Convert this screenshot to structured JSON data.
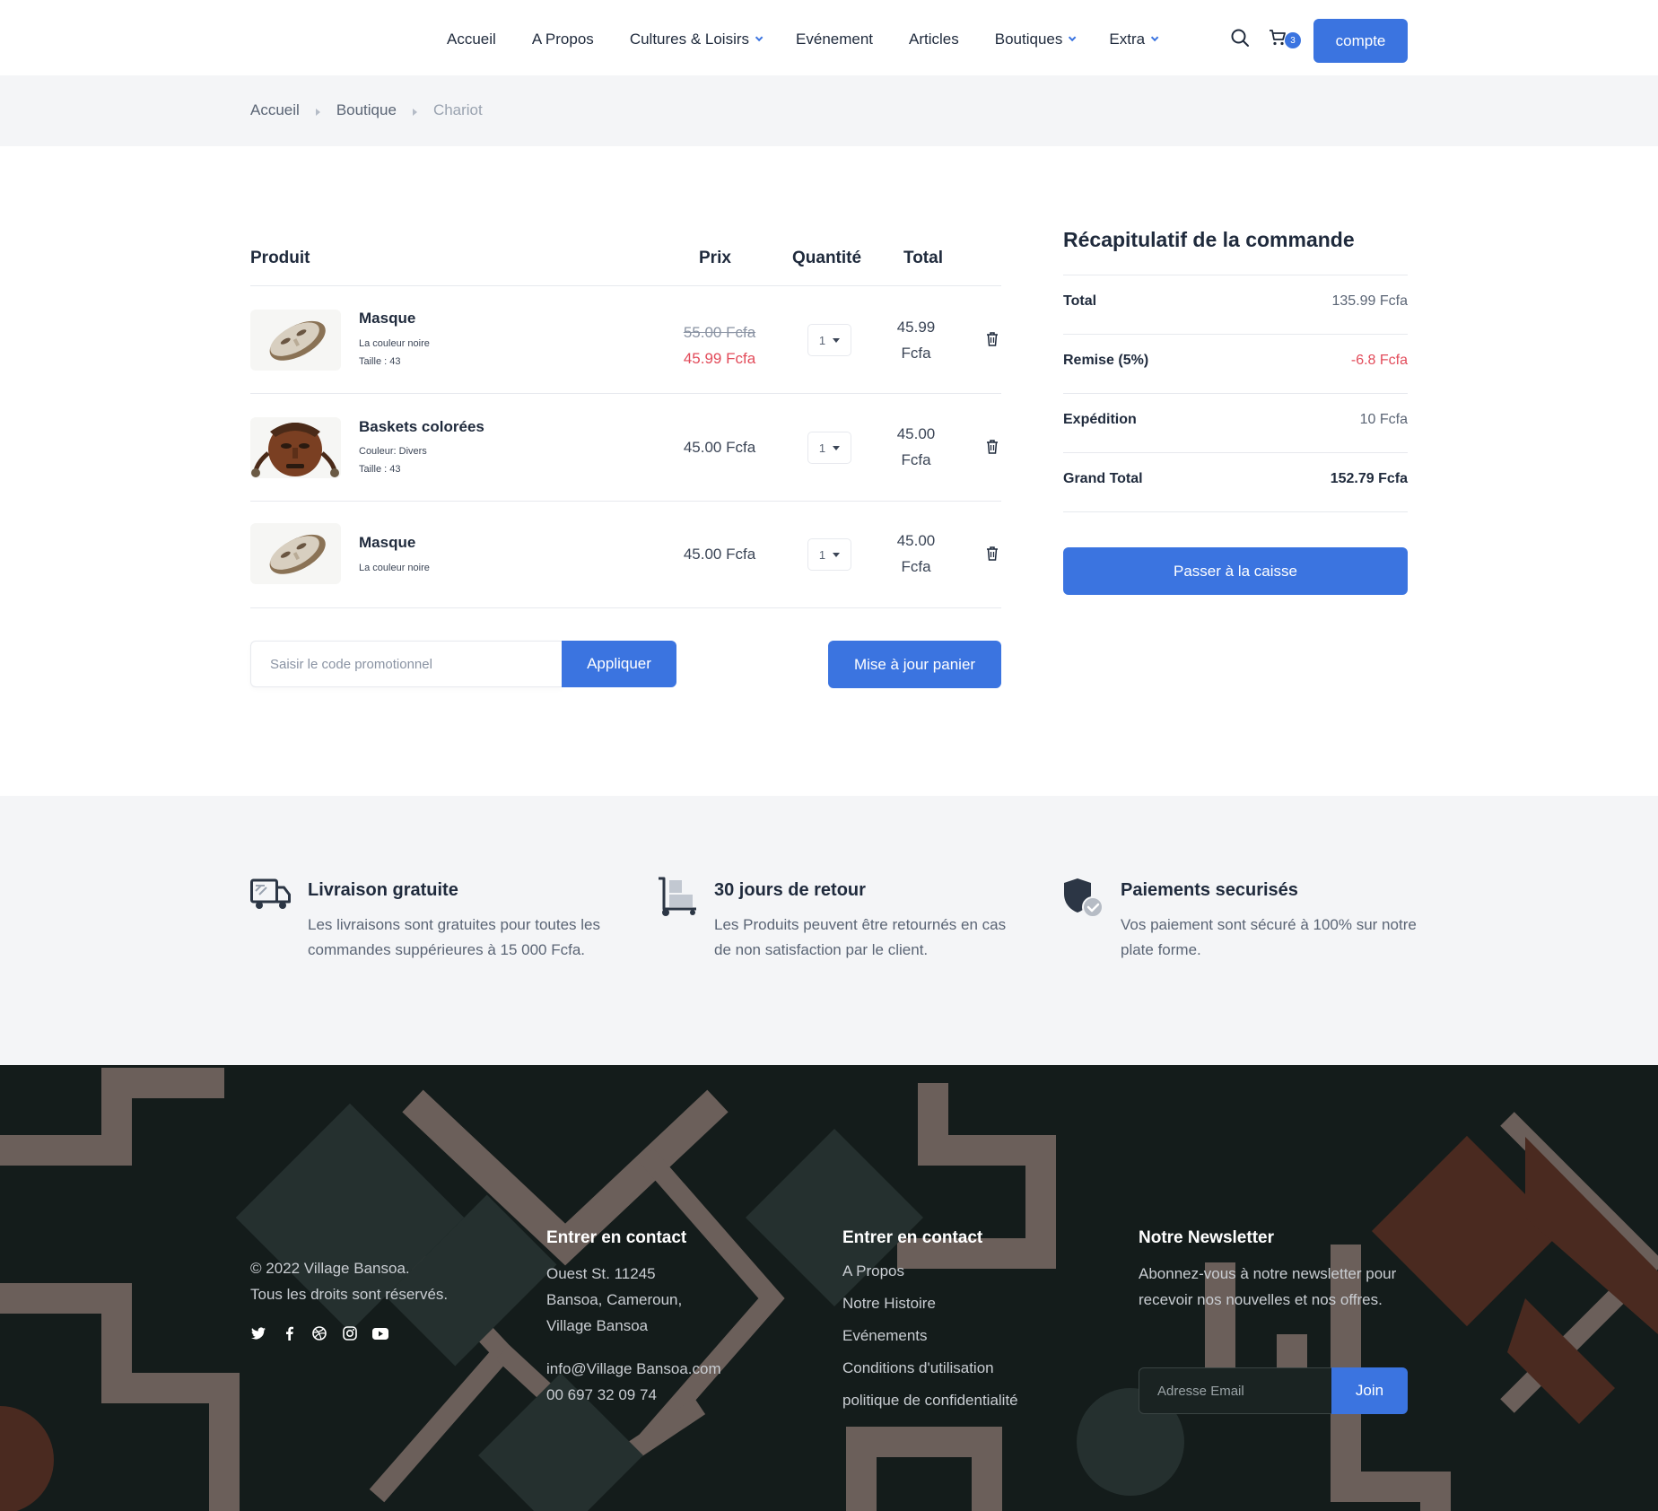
{
  "colors": {
    "accent": "#3b74e0",
    "discount": "#e24b5a",
    "footer_bg": "#141c1b",
    "light_bg": "#f4f5f7"
  },
  "nav": {
    "items": [
      {
        "label": "Accueil",
        "dropdown": false
      },
      {
        "label": "A Propos",
        "dropdown": false
      },
      {
        "label": "Cultures & Loisirs",
        "dropdown": true
      },
      {
        "label": "Evénement",
        "dropdown": false
      },
      {
        "label": "Articles",
        "dropdown": false
      },
      {
        "label": "Boutiques",
        "dropdown": true
      },
      {
        "label": "Extra",
        "dropdown": true
      }
    ],
    "cart_count": "3",
    "account_label": "compte",
    "icons": [
      "search-icon",
      "cart-icon"
    ]
  },
  "breadcrumb": {
    "items": [
      "Accueil",
      "Boutique"
    ],
    "current": "Chariot"
  },
  "cart": {
    "headers": {
      "product": "Produit",
      "price": "Prix",
      "quantity": "Quantité",
      "total": "Total"
    },
    "items": [
      {
        "name": "Masque",
        "meta1": "La couleur noire",
        "meta2": "Taille : 43",
        "old_price": "55.00 Fcfa",
        "price": "45.99 Fcfa",
        "qty": "1",
        "total_line1": "45.99",
        "total_line2": "Fcfa",
        "image": "white-mask"
      },
      {
        "name": "Baskets colorées",
        "meta1": "Couleur: Divers",
        "meta2": "Taille : 43",
        "price": "45.00 Fcfa",
        "qty": "1",
        "total_line1": "45.00",
        "total_line2": "Fcfa",
        "image": "brown-mask"
      },
      {
        "name": "Masque",
        "meta1": "La couleur noire",
        "price": "45.00 Fcfa",
        "qty": "1",
        "total_line1": "45.00",
        "total_line2": "Fcfa",
        "image": "white-mask"
      }
    ],
    "promo_placeholder": "Saisir le code promotionnel",
    "apply_label": "Appliquer",
    "update_label": "Mise à jour panier"
  },
  "summary": {
    "title": "Récapitulatif de la commande",
    "rows": [
      {
        "label": "Total",
        "value": "135.99 Fcfa"
      },
      {
        "label": "Remise (5%)",
        "value": "-6.8 Fcfa"
      },
      {
        "label": "Expédition",
        "value": "10 Fcfa"
      },
      {
        "label": "Grand Total",
        "value": "152.79 Fcfa"
      }
    ],
    "checkout_label": "Passer à la caisse"
  },
  "features": [
    {
      "icon": "truck-icon",
      "title": "Livraison gratuite",
      "text": "Les livraisons sont gratuites pour toutes les commandes suppérieures à 15 000 Fcfa."
    },
    {
      "icon": "hand-truck-icon",
      "title": "30 jours de retour",
      "text": "Les Produits peuvent être retournés en cas de non satisfaction par le client."
    },
    {
      "icon": "shield-check-icon",
      "title": "Paiements securisés",
      "text": "Vos paiement sont sécuré à 100% sur notre plate forme."
    }
  ],
  "footer": {
    "copyright_line1": "© 2022 Village Bansoa.",
    "copyright_line2": "Tous les droits sont réservés.",
    "socials": [
      "twitter-icon",
      "facebook-icon",
      "dribbble-icon",
      "instagram-icon",
      "youtube-icon"
    ],
    "contact": {
      "title": "Entrer en contact",
      "address1": "Ouest St. 11245",
      "address2": "Bansoa, Cameroun,",
      "address3": "Village Bansoa",
      "email": "info@Village Bansoa.com",
      "phone": "00 697 32 09 74"
    },
    "links": {
      "title": "Entrer en contact",
      "items": [
        "A Propos",
        "Notre Histoire",
        "Evénements",
        "Conditions d'utilisation",
        "politique de confidentialité"
      ]
    },
    "newsletter": {
      "title": "Notre Newsletter",
      "text": "Abonnez-vous à notre newsletter pour recevoir nos nouvelles et nos offres.",
      "placeholder": "Adresse Email",
      "join_label": "Join"
    }
  }
}
